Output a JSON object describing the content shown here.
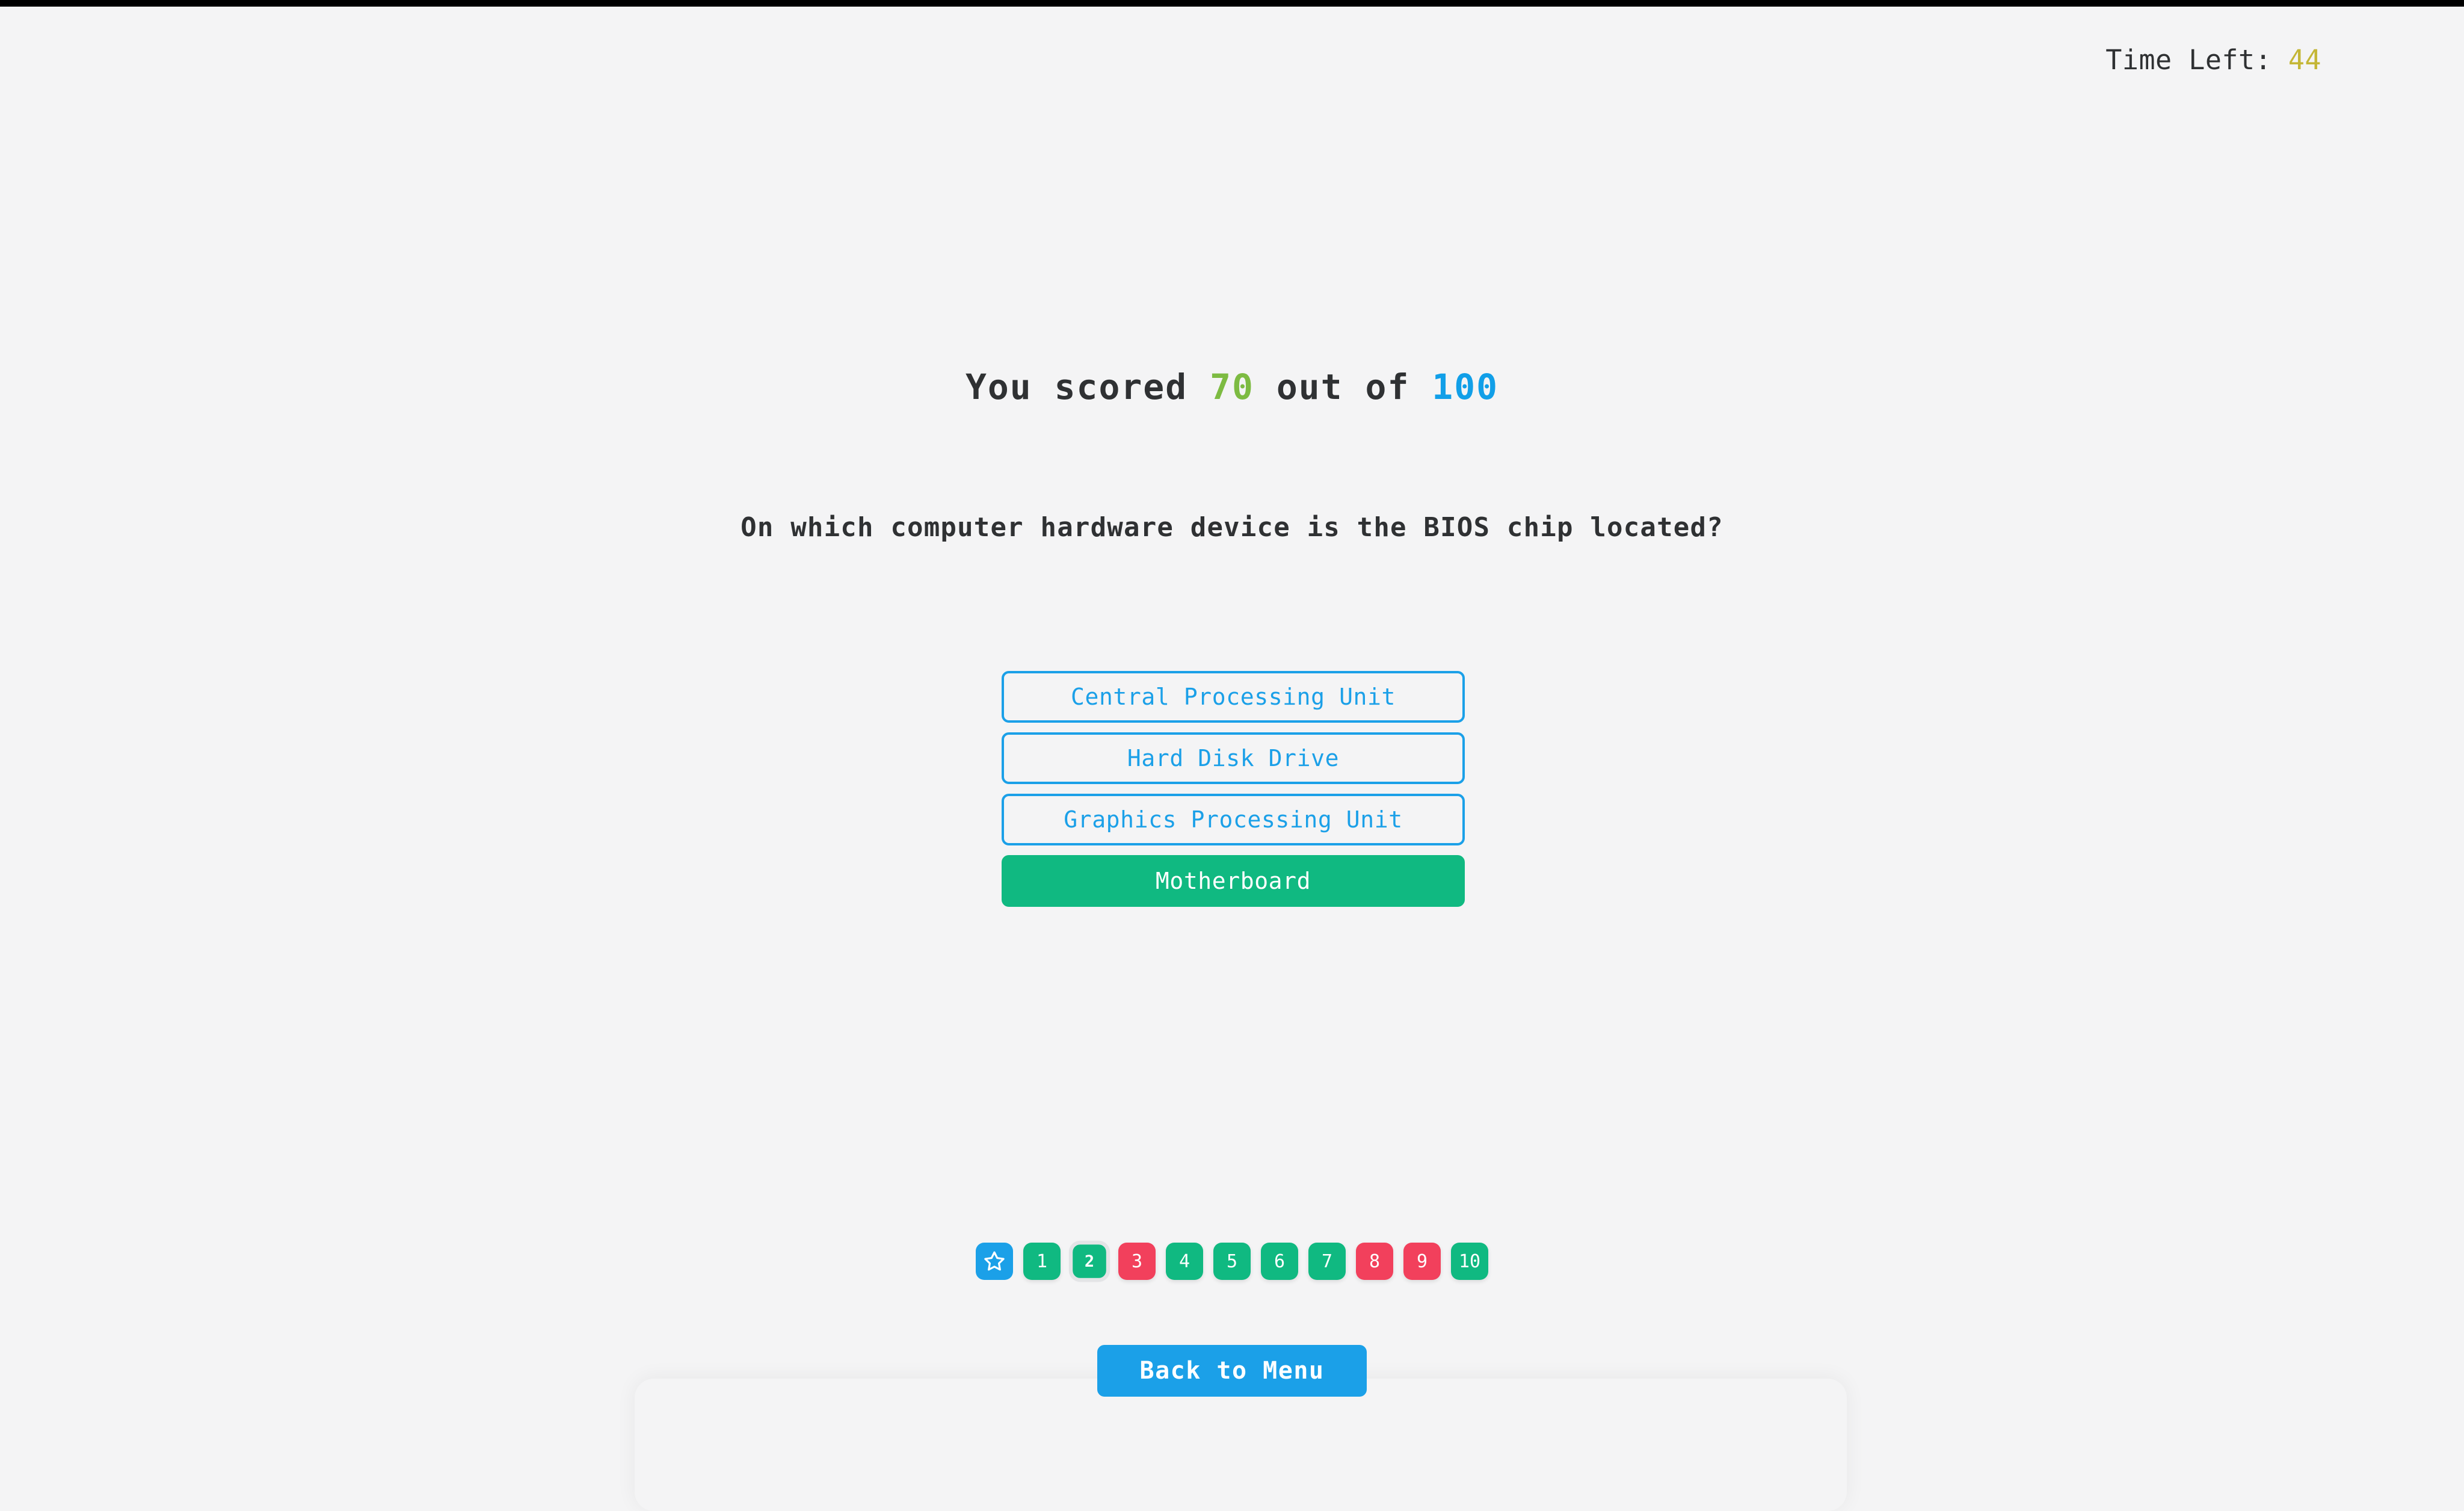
{
  "colors": {
    "background": "#f4f4f5",
    "text": "#2f3133",
    "accent_blue": "#1ba0e8",
    "score_blue": "#119fe8",
    "score_green": "#7dbb42",
    "correct_green": "#10b981",
    "wrong_red": "#f2405c",
    "timer_yellow": "#c4b636",
    "current_ring": "#e3e4e6"
  },
  "timer": {
    "label": "Time Left:",
    "value": "44"
  },
  "score": {
    "prefix": "You scored",
    "value": "70",
    "middle": "out of",
    "total": "100"
  },
  "question": {
    "text": "On which computer hardware device is the BIOS chip located?"
  },
  "options": [
    {
      "label": "Central Processing Unit",
      "state": "outline"
    },
    {
      "label": "Hard Disk Drive",
      "state": "outline"
    },
    {
      "label": "Graphics Processing Unit",
      "state": "outline"
    },
    {
      "label": "Motherboard",
      "state": "correct"
    }
  ],
  "pagination": {
    "star": {
      "icon": "star-icon",
      "state": "star"
    },
    "items": [
      {
        "label": "1",
        "state": "green",
        "current": false
      },
      {
        "label": "2",
        "state": "green",
        "current": true
      },
      {
        "label": "3",
        "state": "red",
        "current": false
      },
      {
        "label": "4",
        "state": "green",
        "current": false
      },
      {
        "label": "5",
        "state": "green",
        "current": false
      },
      {
        "label": "6",
        "state": "green",
        "current": false
      },
      {
        "label": "7",
        "state": "green",
        "current": false
      },
      {
        "label": "8",
        "state": "red",
        "current": false
      },
      {
        "label": "9",
        "state": "red",
        "current": false
      },
      {
        "label": "10",
        "state": "green",
        "current": false
      }
    ]
  },
  "footer": {
    "back_label": "Back to Menu"
  }
}
